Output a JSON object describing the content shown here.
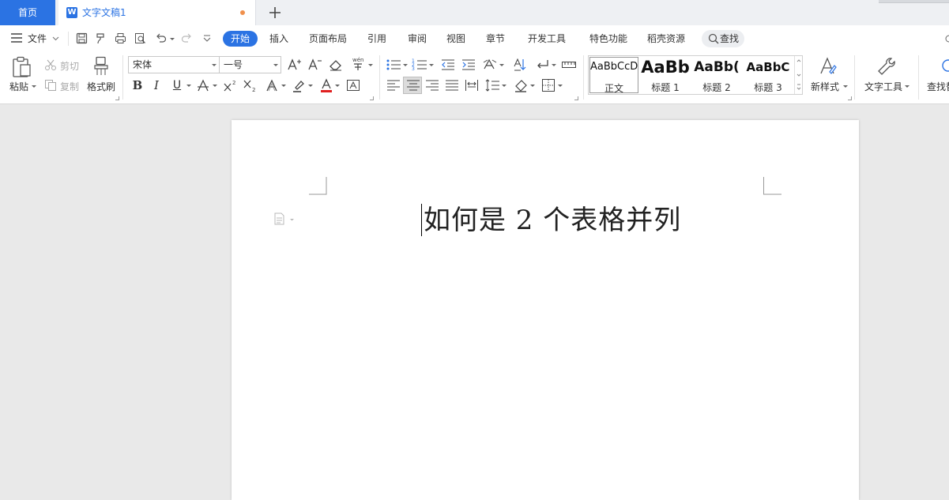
{
  "tabs": {
    "home": "首页",
    "document_title": "文字文稿1",
    "doc_icon_letter": "W"
  },
  "menu": {
    "file": "文件",
    "items": [
      "开始",
      "插入",
      "页面布局",
      "引用",
      "审阅",
      "视图",
      "章节",
      "开发工具",
      "特色功能",
      "稻壳资源"
    ],
    "active": "开始",
    "search": "查找"
  },
  "ribbon": {
    "clipboard": {
      "paste": "粘贴",
      "cut": "剪切",
      "copy": "复制",
      "format_painter": "格式刷"
    },
    "font": {
      "family": "宋体",
      "size": "一号"
    },
    "styles": [
      {
        "preview": "AaBbCcD",
        "name": "正文"
      },
      {
        "preview": "AaBb",
        "name": "标题 1"
      },
      {
        "preview": "AaBb(",
        "name": "标题 2"
      },
      {
        "preview": "AaBbC",
        "name": "标题 3"
      }
    ],
    "new_style": "新样式",
    "text_tools": "文字工具",
    "find_replace": "查找替"
  },
  "document": {
    "text": "如何是 2 个表格并列"
  },
  "colors": {
    "accent": "#2b73e3",
    "font_color_bar": "#e02020",
    "unsaved_dot": "#f0904c"
  }
}
